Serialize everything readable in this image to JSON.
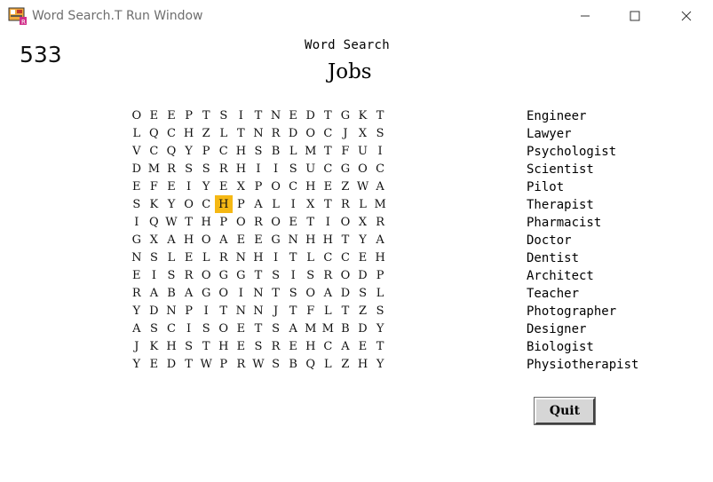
{
  "window": {
    "title": "Word Search.T Run Window",
    "app_icon": "turing-run-icon",
    "controls": [
      "minimize-icon",
      "maximize-icon",
      "close-icon"
    ]
  },
  "score": "533",
  "heading": "Word Search",
  "subheading": "Jobs",
  "grid": [
    [
      "O",
      "E",
      "E",
      "P",
      "T",
      "S",
      "I",
      "T",
      "N",
      "E",
      "D",
      "T",
      "G",
      "K",
      "T"
    ],
    [
      "L",
      "Q",
      "C",
      "H",
      "Z",
      "L",
      "T",
      "N",
      "R",
      "D",
      "O",
      "C",
      "J",
      "X",
      "S"
    ],
    [
      "V",
      "C",
      "Q",
      "Y",
      "P",
      "C",
      "H",
      "S",
      "B",
      "L",
      "M",
      "T",
      "F",
      "U",
      "I"
    ],
    [
      "D",
      "M",
      "R",
      "S",
      "S",
      "R",
      "H",
      "I",
      "I",
      "S",
      "U",
      "C",
      "G",
      "O",
      "C"
    ],
    [
      "E",
      "F",
      "E",
      "I",
      "Y",
      "E",
      "X",
      "P",
      "O",
      "C",
      "H",
      "E",
      "Z",
      "W",
      "A"
    ],
    [
      "S",
      "K",
      "Y",
      "O",
      "C",
      "H",
      "P",
      "A",
      "L",
      "I",
      "X",
      "T",
      "R",
      "L",
      "M"
    ],
    [
      "I",
      "Q",
      "W",
      "T",
      "H",
      "P",
      "O",
      "R",
      "O",
      "E",
      "T",
      "I",
      "O",
      "X",
      "R"
    ],
    [
      "G",
      "X",
      "A",
      "H",
      "O",
      "A",
      "E",
      "E",
      "G",
      "N",
      "H",
      "H",
      "T",
      "Y",
      "A"
    ],
    [
      "N",
      "S",
      "L",
      "E",
      "L",
      "R",
      "N",
      "H",
      "I",
      "T",
      "L",
      "C",
      "C",
      "E",
      "H"
    ],
    [
      "E",
      "I",
      "S",
      "R",
      "O",
      "G",
      "G",
      "T",
      "S",
      "I",
      "S",
      "R",
      "O",
      "D",
      "P"
    ],
    [
      "R",
      "A",
      "B",
      "A",
      "G",
      "O",
      "I",
      "N",
      "T",
      "S",
      "O",
      "A",
      "D",
      "S",
      "L"
    ],
    [
      "Y",
      "D",
      "N",
      "P",
      "I",
      "T",
      "N",
      "N",
      "J",
      "T",
      "F",
      "L",
      "T",
      "Z",
      "S"
    ],
    [
      "A",
      "S",
      "C",
      "I",
      "S",
      "O",
      "E",
      "T",
      "S",
      "A",
      "M",
      "M",
      "B",
      "D",
      "Y"
    ],
    [
      "J",
      "K",
      "H",
      "S",
      "T",
      "H",
      "E",
      "S",
      "R",
      "E",
      "H",
      "C",
      "A",
      "E",
      "T"
    ],
    [
      "Y",
      "E",
      "D",
      "T",
      "W",
      "P",
      "R",
      "W",
      "S",
      "B",
      "Q",
      "L",
      "Z",
      "H",
      "Y"
    ]
  ],
  "highlighted_cell": {
    "row": 5,
    "col": 5,
    "color": "#f5b814"
  },
  "words": [
    "Engineer",
    "Lawyer",
    "Psychologist",
    "Scientist",
    "Pilot",
    "Therapist",
    "Pharmacist",
    "Doctor",
    "Dentist",
    "Architect",
    "Teacher",
    "Photographer",
    "Designer",
    "Biologist",
    "Physiotherapist"
  ],
  "quit_label": "Quit"
}
